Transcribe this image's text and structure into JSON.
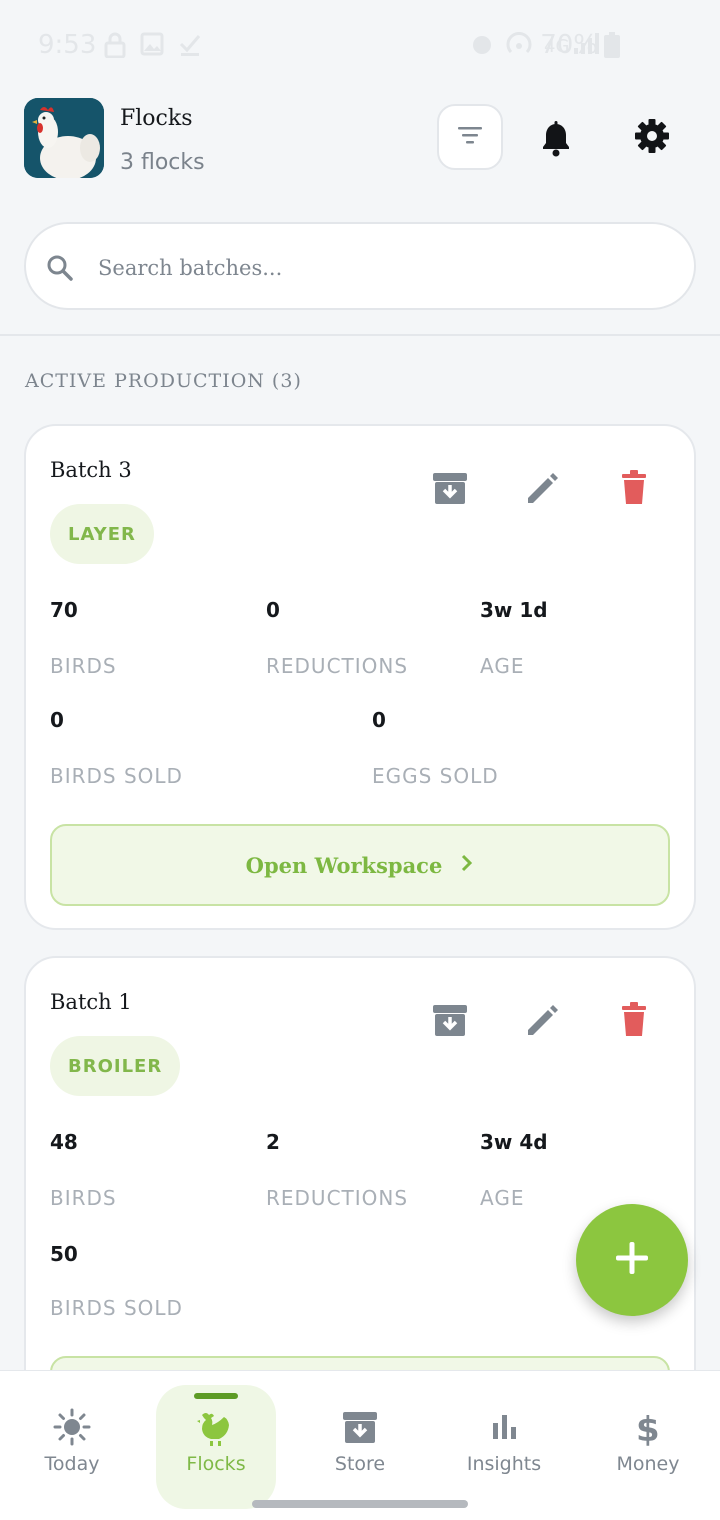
{
  "status_bar": {
    "time": "9:53",
    "battery": "70%",
    "icons": [
      "lock-icon",
      "image-icon",
      "check-icon",
      "alarm-icon",
      "hotspot-icon",
      "signal-icon",
      "battery-icon"
    ]
  },
  "header": {
    "title": "Flocks",
    "subtitle": "3 flocks",
    "icons": [
      "filter-icon",
      "bell-icon",
      "gear-icon"
    ]
  },
  "search": {
    "placeholder": "Search batches...",
    "value": ""
  },
  "section": {
    "label": "ACTIVE PRODUCTION (3)"
  },
  "batches": [
    {
      "name": "Batch 3",
      "type": "LAYER",
      "stats": {
        "birds": "70",
        "birds_label": "BIRDS",
        "reductions": "0",
        "reductions_label": "REDUCTIONS",
        "age": "3w 1d",
        "age_label": "AGE",
        "birds_sold": "0",
        "birds_sold_label": "BIRDS SOLD",
        "eggs_sold": "0",
        "eggs_sold_label": "EGGS SOLD"
      },
      "open_label": "Open Workspace"
    },
    {
      "name": "Batch 1",
      "type": "BROILER",
      "stats": {
        "birds": "48",
        "birds_label": "BIRDS",
        "reductions": "2",
        "reductions_label": "REDUCTIONS",
        "age": "3w 4d",
        "age_label": "AGE",
        "birds_sold": "50",
        "birds_sold_label": "BIRDS SOLD"
      }
    }
  ],
  "fab": {
    "icon": "plus-icon"
  },
  "nav": [
    {
      "label": "Today",
      "icon": "sun-icon"
    },
    {
      "label": "Flocks",
      "icon": "chicken-icon",
      "active": true
    },
    {
      "label": "Store",
      "icon": "archive-icon"
    },
    {
      "label": "Insights",
      "icon": "bar-chart-icon"
    },
    {
      "label": "Money",
      "icon": "dollar-icon"
    }
  ],
  "colors": {
    "accent": "#8cc63f",
    "accent_text": "#7db842",
    "delete": "#e25c5c",
    "muted_icon": "#7d868f"
  }
}
